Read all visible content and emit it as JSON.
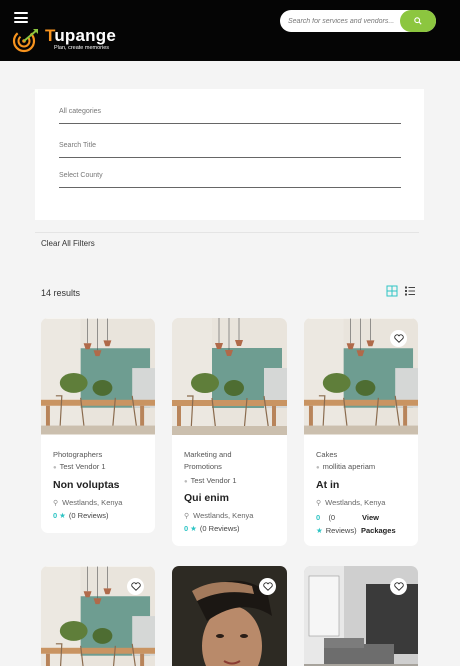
{
  "header": {
    "logo_name_first": "T",
    "logo_name_rest": "upange",
    "logo_tagline": "Plan, create memories",
    "search_placeholder": "Search for services and vendors..."
  },
  "filters": {
    "categories_placeholder": "All categories",
    "title_placeholder": "Search Title",
    "county_placeholder": "Select County",
    "clear_label": "Clear All Filters"
  },
  "results": {
    "count_label": "14 results"
  },
  "cards": [
    {
      "category": "Photographers",
      "vendor": "Test Vendor 1",
      "title": "Non voluptas",
      "location": "Westlands, Kenya",
      "rating": "0",
      "reviews": "(0 Reviews)"
    },
    {
      "category_line1": "Marketing and",
      "category_line2": "Promotions",
      "vendor": "Test Vendor 1",
      "title": "Qui enim",
      "location": "Westlands, Kenya",
      "rating": "0",
      "reviews": "(0 Reviews)"
    },
    {
      "category": "Cakes",
      "vendor": "mollitia aperiam",
      "title": "At in",
      "location": "Westlands, Kenya",
      "rating": "0",
      "reviews_line1": "(0",
      "reviews_line2": "Reviews)",
      "action_line1": "View",
      "action_line2": "Packages"
    }
  ],
  "colors": {
    "header_bg": "#050505",
    "accent_green": "#8cc63f",
    "logo_orange": "#f7931e",
    "rating_teal": "#2ec4c4"
  },
  "icons": [
    "menu-icon",
    "search-icon",
    "grid-view-icon",
    "list-view-icon",
    "heart-icon",
    "location-pin-icon",
    "star-icon"
  ]
}
